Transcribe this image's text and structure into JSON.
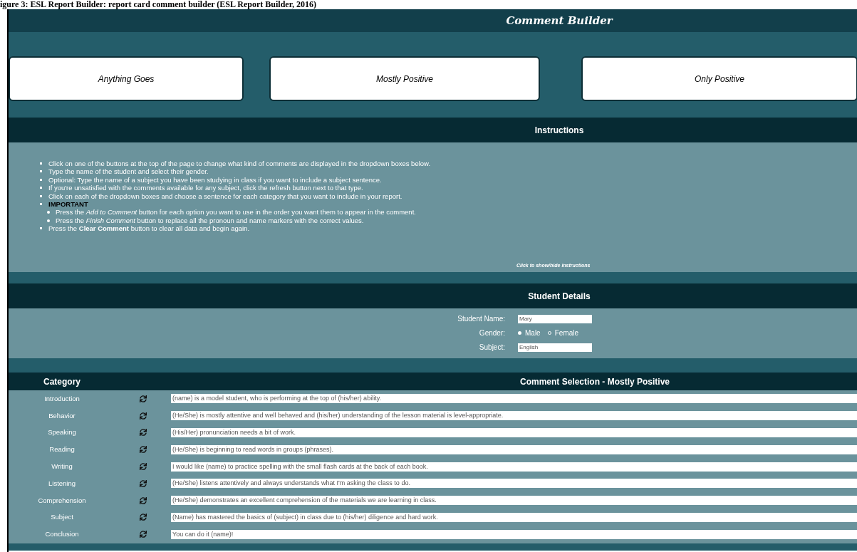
{
  "caption": "igure 3: ESL Report Builder: report card comment builder (ESL Report Builder, 2016)",
  "title": "Comment Builder",
  "modes": [
    {
      "label": "Anything Goes"
    },
    {
      "label": "Mostly Positive"
    },
    {
      "label": "Only Positive"
    }
  ],
  "instructions": {
    "heading": "Instructions",
    "items": [
      {
        "text": "Click on one of the buttons at the top of the page to change what kind of comments are displayed in the dropdown boxes below."
      },
      {
        "text": "Type the name of the student and select their gender."
      },
      {
        "text": "Optional: Type the name of a subject you have been studying in class if you want to include a subject sentence."
      },
      {
        "text": "If you're unsatisfied with the comments available for any subject, click the refresh button next to that type."
      },
      {
        "text": "Click on each of the dropdown boxes and choose a sentence for each category that you want to include in your report."
      },
      {
        "text": "**IMPORTANT**",
        "children": [
          {
            "text": "Press the *Add to Comment* button for each option you want to use in the order you want them to appear in the comment."
          },
          {
            "text": "Press the *Finish Comment* button to replace all the pronoun and name markers with the correct values."
          }
        ]
      },
      {
        "text": "Press the **Clear Comment** button to clear all data and begin again."
      }
    ],
    "toggle": "Click to show/hide instructions"
  },
  "student_details": {
    "heading": "Student Details",
    "name_label": "Student Name:",
    "name_value": "Mary",
    "gender_label": "Gender:",
    "genders": [
      {
        "label": "Male",
        "selected": true
      },
      {
        "label": "Female",
        "selected": false
      }
    ],
    "subject_label": "Subject:",
    "subject_value": "English"
  },
  "comments": {
    "category_heading": "Category",
    "selection_heading": "Comment Selection - Mostly Positive",
    "rows": [
      {
        "category": "Introduction",
        "comment": "(name) is a model student, who is performing at the top of (his/her) ability."
      },
      {
        "category": "Behavior",
        "comment": "(He/She) is mostly attentive and well behaved and (his/her) understanding of the lesson material is level-appropriate."
      },
      {
        "category": "Speaking",
        "comment": "(His/Her) pronunciation needs a bit of work."
      },
      {
        "category": "Reading",
        "comment": "(He/She) is beginning to read words in groups (phrases)."
      },
      {
        "category": "Writing",
        "comment": "I would like (name) to practice spelling with the small flash cards at the back of each book."
      },
      {
        "category": "Listening",
        "comment": "(He/She) listens attentively and always understands what I'm asking the class to do."
      },
      {
        "category": "Comprehension",
        "comment": "(He/She) demonstrates an excellent comprehension of the materials we are learning in class."
      },
      {
        "category": "Subject",
        "comment": "(Name) has mastered the basics of (subject) in class due to (his/her) diligence and hard work."
      },
      {
        "category": "Conclusion",
        "comment": "You can do it (name)!"
      }
    ]
  }
}
